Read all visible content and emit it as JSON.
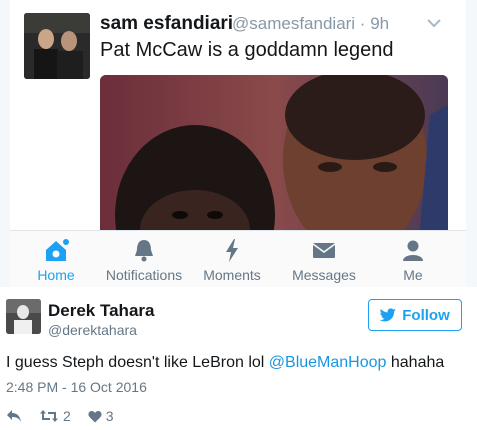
{
  "embedded": {
    "name": "sam esfandiari",
    "handle": "@samesfandiari · 9h",
    "text": "Pat McCaw is a goddamn legend",
    "tabs": [
      {
        "label": "Home",
        "icon": "home-icon",
        "active": true
      },
      {
        "label": "Notifications",
        "icon": "bell-icon",
        "active": false
      },
      {
        "label": "Moments",
        "icon": "lightning-icon",
        "active": false
      },
      {
        "label": "Messages",
        "icon": "envelope-icon",
        "active": false
      },
      {
        "label": "Me",
        "icon": "person-icon",
        "active": false
      }
    ]
  },
  "tweet": {
    "name": "Derek Tahara",
    "handle": "@derektahara",
    "follow_label": "Follow",
    "text_before": "I guess Steph doesn't like LeBron lol ",
    "mention": "@BlueManHoop",
    "text_after": " hahaha",
    "timestamp": "2:48 PM - 16 Oct 2016",
    "retweets": "2",
    "likes": "3"
  },
  "colors": {
    "accent": "#1da1f2",
    "text": "#14171a",
    "muted": "#657786"
  }
}
